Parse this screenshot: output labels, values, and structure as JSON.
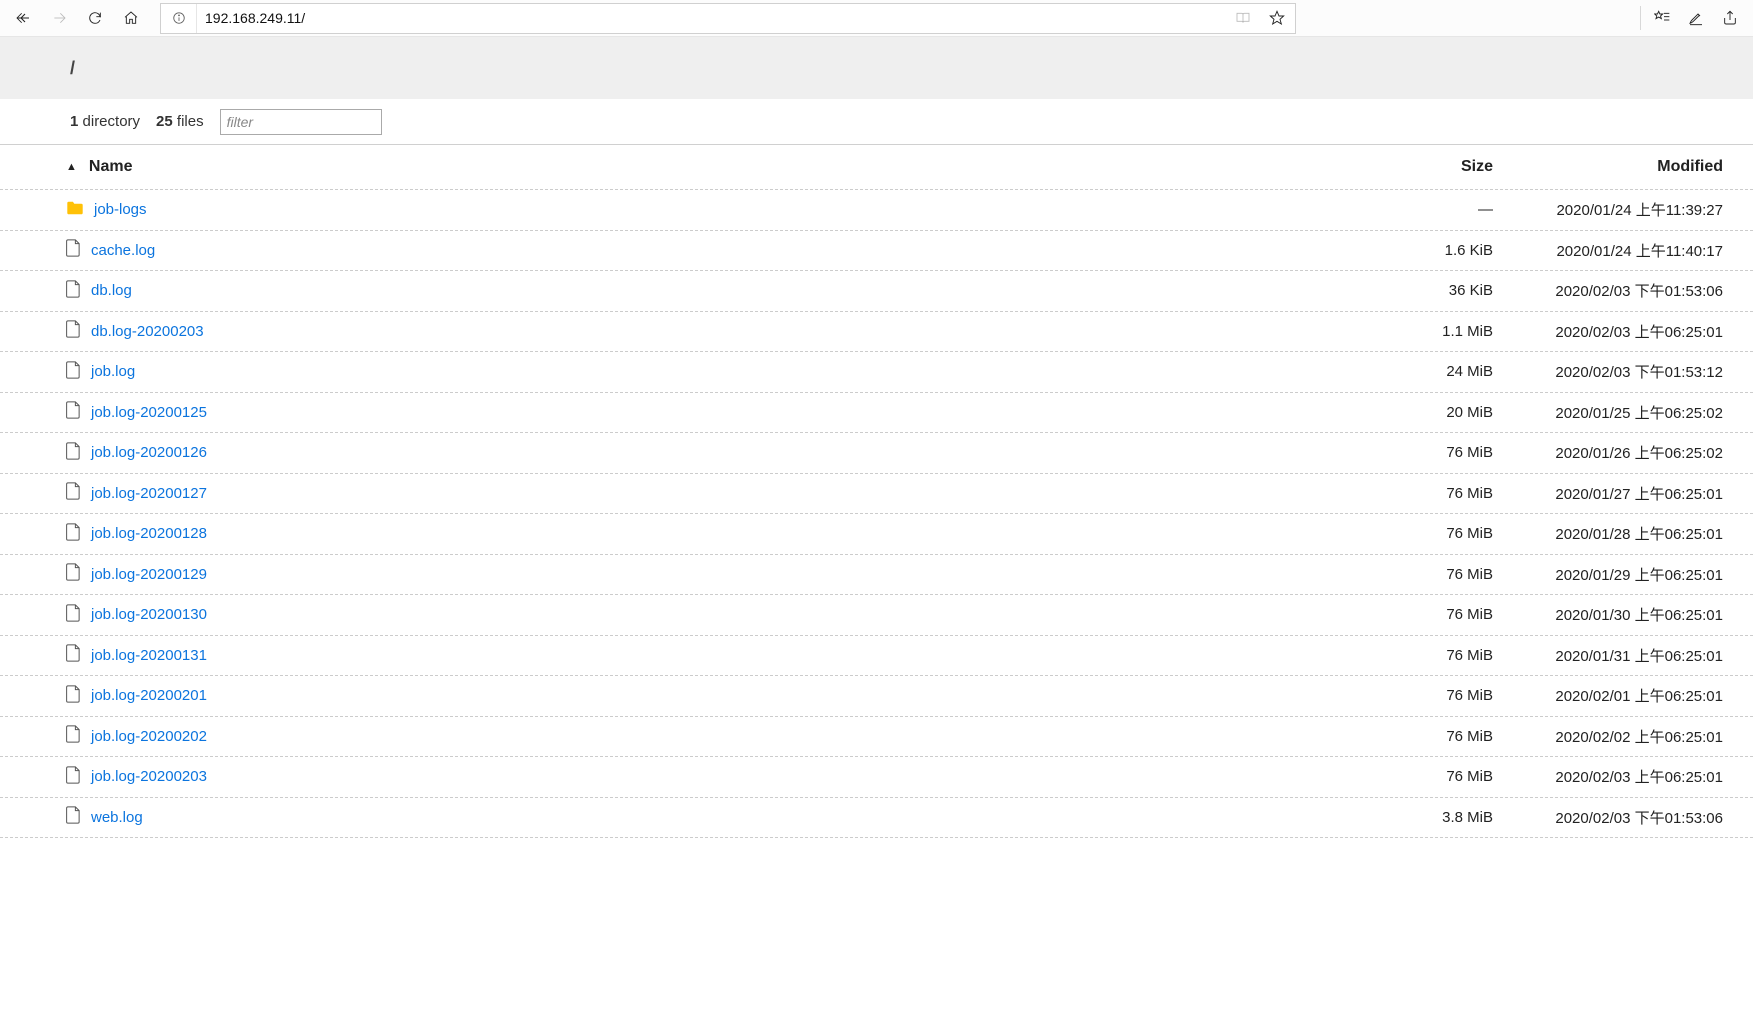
{
  "toolbar": {
    "url": "192.168.249.11/"
  },
  "breadcrumb": "/",
  "stats": {
    "dir_count": "1",
    "dir_label": "directory",
    "file_count": "25",
    "file_label": "files"
  },
  "filter": {
    "placeholder": "filter"
  },
  "headers": {
    "name": "Name",
    "size": "Size",
    "modified": "Modified"
  },
  "rows": [
    {
      "type": "dir",
      "name": "job-logs",
      "size": "—",
      "modified": "2020/01/24 上午11:39:27"
    },
    {
      "type": "file",
      "name": "cache.log",
      "size": "1.6 KiB",
      "modified": "2020/01/24 上午11:40:17"
    },
    {
      "type": "file",
      "name": "db.log",
      "size": "36 KiB",
      "modified": "2020/02/03 下午01:53:06"
    },
    {
      "type": "file",
      "name": "db.log-20200203",
      "size": "1.1 MiB",
      "modified": "2020/02/03 上午06:25:01"
    },
    {
      "type": "file",
      "name": "job.log",
      "size": "24 MiB",
      "modified": "2020/02/03 下午01:53:12"
    },
    {
      "type": "file",
      "name": "job.log-20200125",
      "size": "20 MiB",
      "modified": "2020/01/25 上午06:25:02"
    },
    {
      "type": "file",
      "name": "job.log-20200126",
      "size": "76 MiB",
      "modified": "2020/01/26 上午06:25:02"
    },
    {
      "type": "file",
      "name": "job.log-20200127",
      "size": "76 MiB",
      "modified": "2020/01/27 上午06:25:01"
    },
    {
      "type": "file",
      "name": "job.log-20200128",
      "size": "76 MiB",
      "modified": "2020/01/28 上午06:25:01"
    },
    {
      "type": "file",
      "name": "job.log-20200129",
      "size": "76 MiB",
      "modified": "2020/01/29 上午06:25:01"
    },
    {
      "type": "file",
      "name": "job.log-20200130",
      "size": "76 MiB",
      "modified": "2020/01/30 上午06:25:01"
    },
    {
      "type": "file",
      "name": "job.log-20200131",
      "size": "76 MiB",
      "modified": "2020/01/31 上午06:25:01"
    },
    {
      "type": "file",
      "name": "job.log-20200201",
      "size": "76 MiB",
      "modified": "2020/02/01 上午06:25:01"
    },
    {
      "type": "file",
      "name": "job.log-20200202",
      "size": "76 MiB",
      "modified": "2020/02/02 上午06:25:01"
    },
    {
      "type": "file",
      "name": "job.log-20200203",
      "size": "76 MiB",
      "modified": "2020/02/03 上午06:25:01"
    },
    {
      "type": "file",
      "name": "web.log",
      "size": "3.8 MiB",
      "modified": "2020/02/03 下午01:53:06"
    }
  ]
}
